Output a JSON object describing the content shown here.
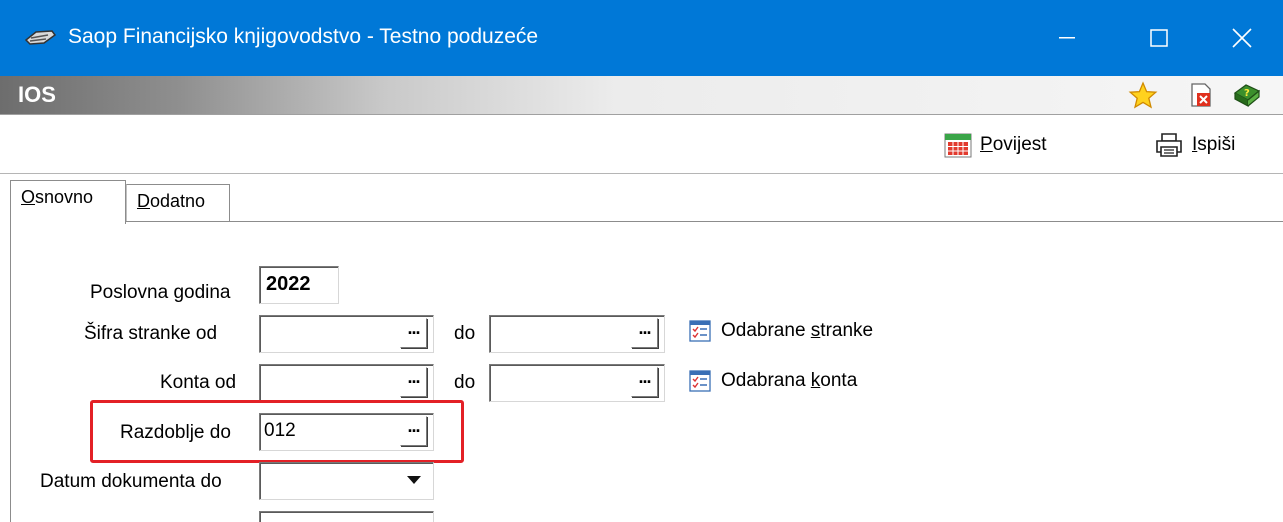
{
  "window": {
    "title": "Saop Financijsko knjigovodstvo - Testno poduzeće",
    "app_icon": "saop-app-icon",
    "controls": [
      "minimize-icon",
      "maximize-icon",
      "close-icon"
    ]
  },
  "module": {
    "title": "IOS",
    "icons": [
      "star-icon",
      "document-close-icon",
      "help-icon"
    ]
  },
  "toolbar": {
    "povijest": {
      "label_underlined": "P",
      "label_rest": "ovijest",
      "icon": "calendar-icon"
    },
    "ispisi": {
      "label_underlined": "I",
      "label_rest": "spiši",
      "icon": "printer-icon"
    }
  },
  "tabs": [
    {
      "label_underlined": "O",
      "label_rest": "snovno",
      "active": true
    },
    {
      "label_underlined": "D",
      "label_rest": "odatno",
      "active": false
    }
  ],
  "form": {
    "poslovna_godina": {
      "label": "Poslovna godina",
      "value": "2022"
    },
    "sifra_stranke": {
      "label": "Šifra stranke od",
      "from_value": "",
      "to_label": "do",
      "to_value": "",
      "picker_label": "Odabrane ",
      "picker_underlined": "s",
      "picker_rest": "tranke"
    },
    "konta": {
      "label": "Konta od",
      "from_value": "",
      "to_label": "do",
      "to_value": "",
      "picker_label": "Odabrana ",
      "picker_underlined": "k",
      "picker_rest": "onta"
    },
    "razdoblje": {
      "label": "Razdoblje do",
      "value": "012"
    },
    "datum_dokumenta": {
      "label": "Datum dokumenta do",
      "value": ""
    },
    "lookup_glyph": "..."
  },
  "colors": {
    "titlebar": "#0078d7",
    "highlight": "#e32026"
  }
}
